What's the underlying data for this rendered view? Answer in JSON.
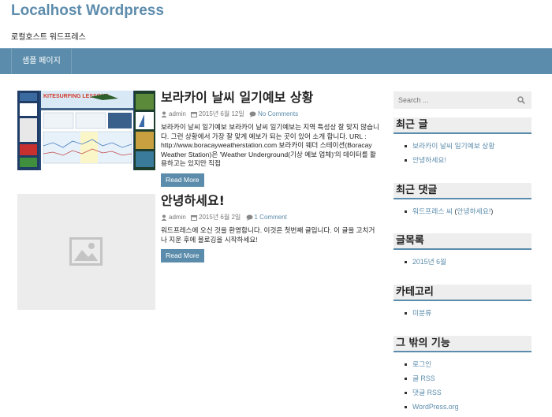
{
  "site": {
    "title": "Localhost Wordpress",
    "description": "로컬호스트 워드프레스"
  },
  "nav": {
    "items": [
      {
        "label": "샘플 페이지"
      }
    ]
  },
  "posts": [
    {
      "title": "보라카이 날씨 일기예보 상황",
      "author": "admin",
      "date": "2015년 6월 12일",
      "comments": "No Comments",
      "excerpt": "보라카이 날씨 일기예보    보라카이 날씨 일기예보는 지역 특성상 잘 맞지 않습니다. 그런 상황에서 가장 잘 맞게 예보가 되는 곳이 있어 소개 합니다. URL : http://www.boracayweatherstation.com   보라카이 웨더 스테이션(Boracay Weather Station)은 'Weather Underground(기상 예보 업체)'의 데이터를 활용하고는 있지만 직접",
      "read_more": "Read More",
      "thumb_headline": "KITESURFING LESSONS"
    },
    {
      "title": "안녕하세요!",
      "author": "admin",
      "date": "2015년 6월 2일",
      "comments": "1 Comment",
      "excerpt": "워드프레스에 오신 것을 환영합니다. 이것은 첫번째 글입니다. 이 글을 고치거나 지운 후에 블로깅을 시작하세요!",
      "read_more": "Read More"
    }
  ],
  "sidebar": {
    "search_placeholder": "Search ...",
    "recent_posts": {
      "title": "최근 글",
      "items": [
        "보라카이 날씨 일기예보 상황",
        "안녕하세요!"
      ]
    },
    "recent_comments": {
      "title": "최근 댓글",
      "author": "워드프레스 씨",
      "post": "안녕하세요!"
    },
    "archives": {
      "title": "글목록",
      "items": [
        "2015년 6월"
      ]
    },
    "categories": {
      "title": "카테고리",
      "items": [
        "미분류"
      ]
    },
    "meta": {
      "title": "그 밖의 기능",
      "items": [
        "로그인",
        "글 RSS",
        "댓글 RSS",
        "WordPress.org"
      ]
    }
  },
  "colors": {
    "accent": "#5b8cab",
    "title": "#5d8cad",
    "widget_bg": "#eeeeee"
  }
}
